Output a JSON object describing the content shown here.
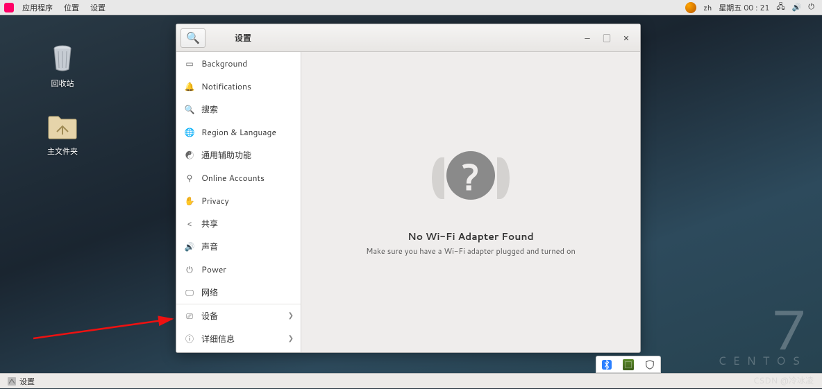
{
  "top_panel": {
    "logo": "centos-logo",
    "menus": [
      "应用程序",
      "位置",
      "设置"
    ],
    "lang": "zh",
    "clock": "星期五 00 : 21",
    "tray_icons": [
      "network-icon",
      "volume-icon",
      "power-icon"
    ]
  },
  "desktop": {
    "trash_label": "回收站",
    "home_label": "主文件夹"
  },
  "centos": {
    "version": "7",
    "brand": "CENTOS"
  },
  "window": {
    "title": "设置",
    "sidebar": {
      "items": [
        {
          "icon": "display-icon",
          "glyph": "▭",
          "label": "Background"
        },
        {
          "icon": "bell-icon",
          "glyph": "🔔",
          "label": "Notifications"
        },
        {
          "icon": "search-icon",
          "glyph": "🔍",
          "label": "搜索"
        },
        {
          "icon": "globe-icon",
          "glyph": "🌐",
          "label": "Region & Language"
        },
        {
          "icon": "accessibility-icon",
          "glyph": "☯",
          "label": "通用辅助功能"
        },
        {
          "icon": "accounts-icon",
          "glyph": "⚲",
          "label": "Online Accounts"
        },
        {
          "icon": "privacy-icon",
          "glyph": "✋",
          "label": "Privacy"
        },
        {
          "icon": "share-icon",
          "glyph": "<",
          "label": "共享"
        },
        {
          "icon": "sound-icon",
          "glyph": "🔊",
          "label": "声音"
        },
        {
          "icon": "power-icon",
          "glyph": "⏻",
          "label": "Power"
        },
        {
          "icon": "network-icon",
          "glyph": "🖵",
          "label": "网络"
        }
      ],
      "items_ext": [
        {
          "icon": "devices-icon",
          "glyph": "⎚",
          "label": "设备",
          "chevron": true
        },
        {
          "icon": "details-icon",
          "glyph": "ⓘ",
          "label": "详细信息",
          "chevron": true
        }
      ]
    },
    "content": {
      "title": "No Wi-Fi Adapter Found",
      "subtitle": "Make sure you have a Wi-Fi adapter plugged and turned on"
    },
    "controls": {
      "minimize": "—",
      "maximize": "▢",
      "close": "✕"
    }
  },
  "taskbar": {
    "item_label": "设置"
  },
  "tray_pop": {
    "bluetooth": "bluetooth-icon",
    "gpu": "nvidia-icon",
    "security": "shield-icon"
  },
  "watermark": "CSDN @冷冰凌"
}
